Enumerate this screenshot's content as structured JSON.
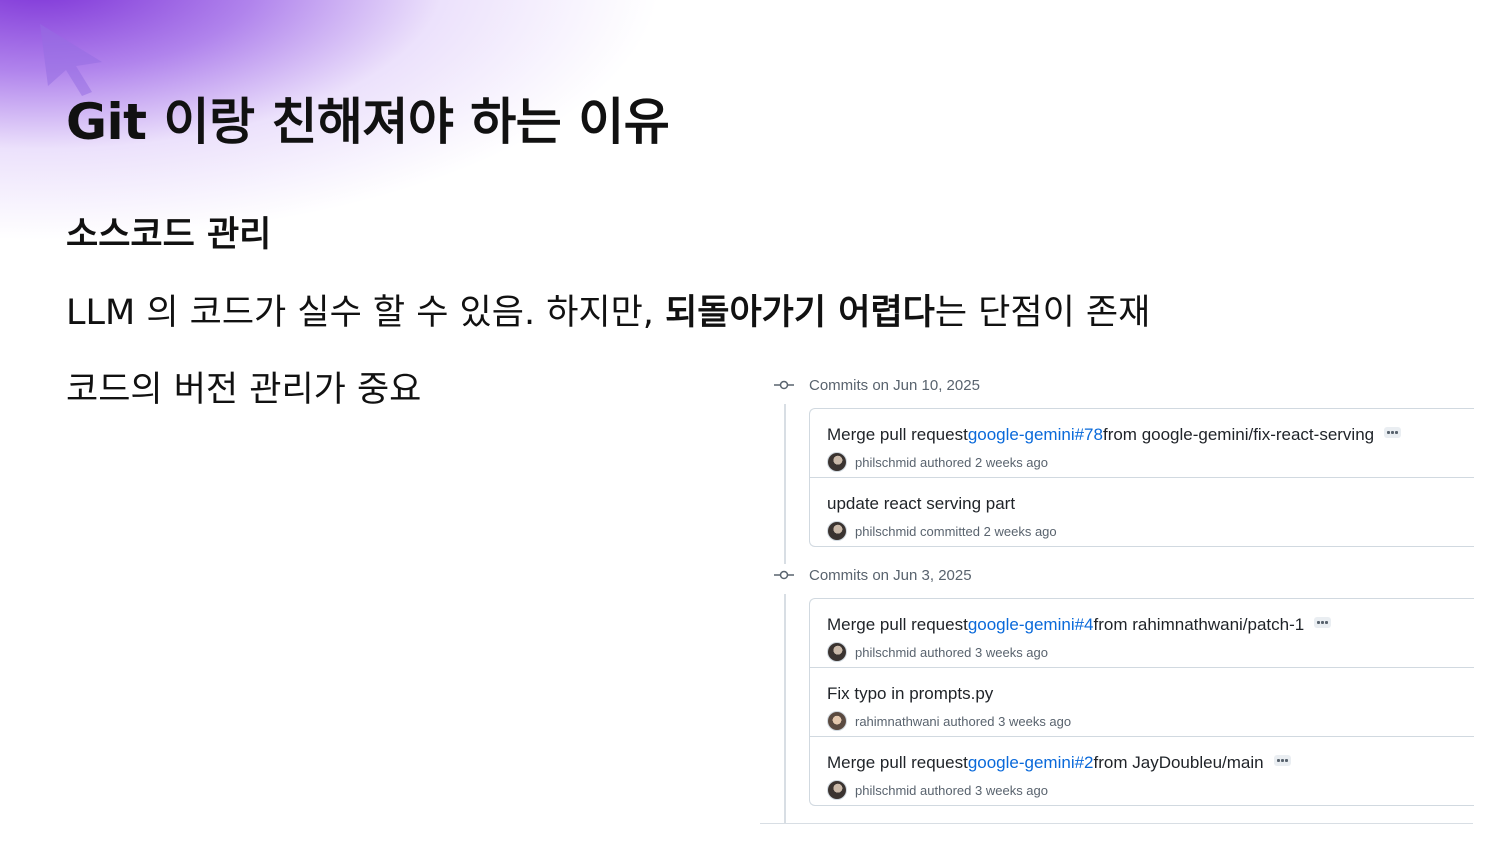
{
  "slide": {
    "title": "Git 이랑 친해져야 하는 이유",
    "subheading": "소스코드 관리",
    "line1_before": "LLM 의 코드가 실수 할 수 있음. 하지만, ",
    "line1_bold": "되돌아가기 어렵다",
    "line1_after": "는 단점이 존재",
    "line2": "코드의 버전 관리가 중요"
  },
  "commits": {
    "groups": [
      {
        "label": "Commits on Jun 10, 2025",
        "items": [
          {
            "msg_prefix": "Merge pull request ",
            "link": "google-gemini#78",
            "msg_suffix": " from google-gemini/fix-react-serving",
            "message": "",
            "author": "philschmid",
            "action": "authored",
            "time": "2 weeks ago"
          },
          {
            "msg_prefix": "",
            "link": "",
            "msg_suffix": "",
            "message": "update react serving part",
            "author": "philschmid",
            "action": "committed",
            "time": "2 weeks ago"
          }
        ]
      },
      {
        "label": "Commits on Jun 3, 2025",
        "items": [
          {
            "msg_prefix": "Merge pull request ",
            "link": "google-gemini#4",
            "msg_suffix": " from rahimnathwani/patch-1",
            "message": "",
            "author": "philschmid",
            "action": "authored",
            "time": "3 weeks ago"
          },
          {
            "msg_prefix": "",
            "link": "",
            "msg_suffix": "",
            "message": "Fix typo in prompts.py",
            "author": "rahimnathwani",
            "action": "authored",
            "time": "3 weeks ago"
          },
          {
            "msg_prefix": "Merge pull request ",
            "link": "google-gemini#2",
            "msg_suffix": " from JayDoubleu/main",
            "message": "",
            "author": "philschmid",
            "action": "authored",
            "time": "3 weeks ago"
          }
        ]
      }
    ]
  },
  "colors": {
    "accent_purple": "#7b2fd6",
    "link_blue": "#0969da",
    "muted_text": "#59636e"
  }
}
